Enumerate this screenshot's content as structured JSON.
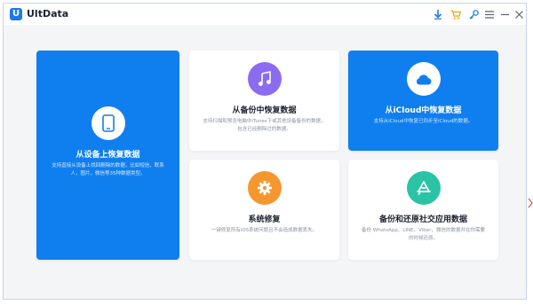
{
  "app": {
    "logo_letter": "U",
    "title": "UltData"
  },
  "toolbar": {
    "icons": [
      "download-icon",
      "cart-icon",
      "key-icon",
      "menu-icon",
      "minimize-icon",
      "close-icon"
    ]
  },
  "cards": {
    "device": {
      "title": "从设备上恢复数据",
      "desc": "支持直接从设备上找回删除的数据，比如短信，联系人，图片，微信等35种数据类型。"
    },
    "itunes": {
      "title": "从备份中恢复数据",
      "desc": "支持扫描和预览电脑中iTunes下或其他设备备份的数据，包含已经删除过的数据。"
    },
    "icloud": {
      "title": "从iCloud中恢复数据",
      "desc": "支持从iCloud中恢复已同步至iCloud的数据。"
    },
    "system": {
      "title": "系统修复",
      "desc": "一键修复所有iOS系统问题且不会造成数据丢失。"
    },
    "social": {
      "title": "备份和还原社交应用数据",
      "desc": "备份 WhatsApp、LINE、Viber、微信的数据并在你需要的时候还原。"
    }
  },
  "colors": {
    "accent": "#0f7ff0",
    "music": "#8b6cf0",
    "repair": "#f5962f",
    "social": "#2bc3a6"
  }
}
